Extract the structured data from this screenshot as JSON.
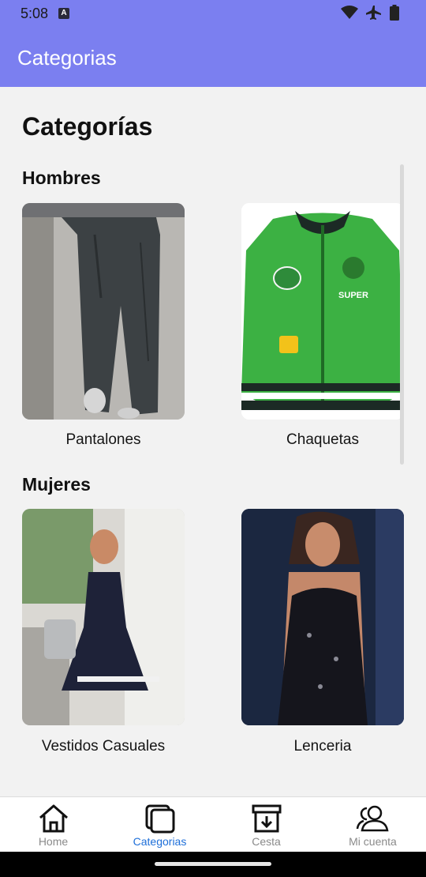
{
  "status_bar": {
    "time": "5:08"
  },
  "app_bar": {
    "title": "Categorias"
  },
  "page": {
    "title": "Categorías"
  },
  "sections": [
    {
      "title": "Hombres",
      "items": [
        {
          "label": "Pantalones",
          "image": "photo of grey wide-leg pants"
        },
        {
          "label": "Chaquetas",
          "image": "green Super Mario bomber jacket"
        }
      ]
    },
    {
      "title": "Mujeres",
      "items": [
        {
          "label": "Vestidos Casuales",
          "image": "woman in navy casual dress"
        },
        {
          "label": "Lenceria",
          "image": "black lace lingerie"
        }
      ]
    }
  ],
  "bottom_nav": [
    {
      "label": "Home",
      "icon": "home-icon",
      "active": false
    },
    {
      "label": "Categorias",
      "icon": "categories-icon",
      "active": true
    },
    {
      "label": "Cesta",
      "icon": "cart-box-icon",
      "active": false
    },
    {
      "label": "Mi cuenta",
      "icon": "account-icon",
      "active": false
    }
  ],
  "colors": {
    "app_bar": "#7b7ff0",
    "active_nav": "#1e6fd9",
    "inactive_nav": "#8a8a8a"
  }
}
